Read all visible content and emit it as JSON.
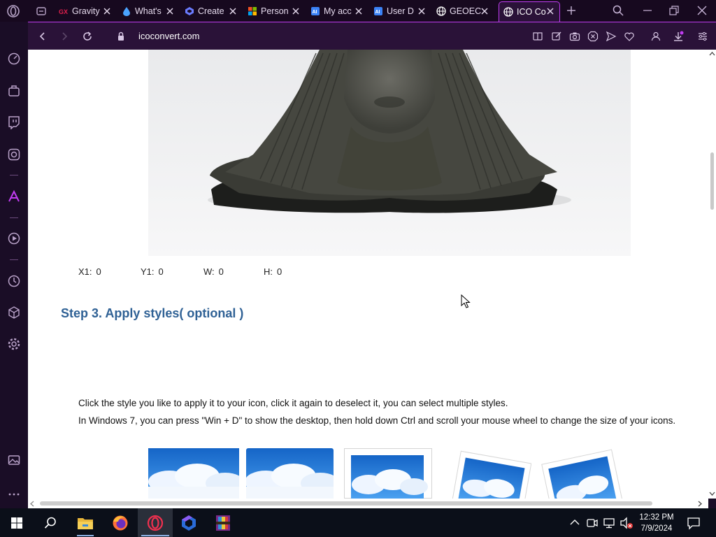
{
  "browser": {
    "tabs": [
      {
        "title": "Gravity",
        "favicon": "gx-icon",
        "color": "#e0204d"
      },
      {
        "title": "What's",
        "favicon": "drop-icon",
        "color": "#4aa3ff"
      },
      {
        "title": "Create",
        "favicon": "copilot-icon",
        "color": "#6a7cff"
      },
      {
        "title": "Person",
        "favicon": "microsoft-icon",
        "color": "#f25022"
      },
      {
        "title": "My acc",
        "favicon": "azure-ai-icon",
        "color": "#3b82f6"
      },
      {
        "title": "User D",
        "favicon": "azure-ai-icon",
        "color": "#3b82f6"
      },
      {
        "title": "GEOEC",
        "favicon": "globe-icon",
        "color": "#ffffff"
      },
      {
        "title": "ICO Co",
        "favicon": "globe-icon",
        "color": "#ffffff",
        "active": true
      }
    ],
    "url": "icoconvert.com",
    "accent": "#c13cf2"
  },
  "page": {
    "coords": [
      {
        "label": "X1:",
        "value": "0"
      },
      {
        "label": "Y1:",
        "value": "0"
      },
      {
        "label": "W:",
        "value": "0"
      },
      {
        "label": "H:",
        "value": "0"
      }
    ],
    "step3_title": "Step 3. Apply styles( optional )",
    "instructions": [
      "Click the style you like to apply it to your icon, click it again to deselect it, you can select multiple styles.",
      "In Windows 7, you can press \"Win + D\" to show the desktop, then hold down Ctrl and scroll your mouse wheel to change the size of your icons."
    ],
    "heading_color": "#2f6195"
  },
  "taskbar": {
    "time": "12:32 PM",
    "date": "7/9/2024",
    "apps": [
      "windows-start-icon",
      "search-icon",
      "file-explorer-icon",
      "firefox-icon",
      "opera-gx-icon",
      "copilot-icon",
      "winrar-icon"
    ]
  }
}
